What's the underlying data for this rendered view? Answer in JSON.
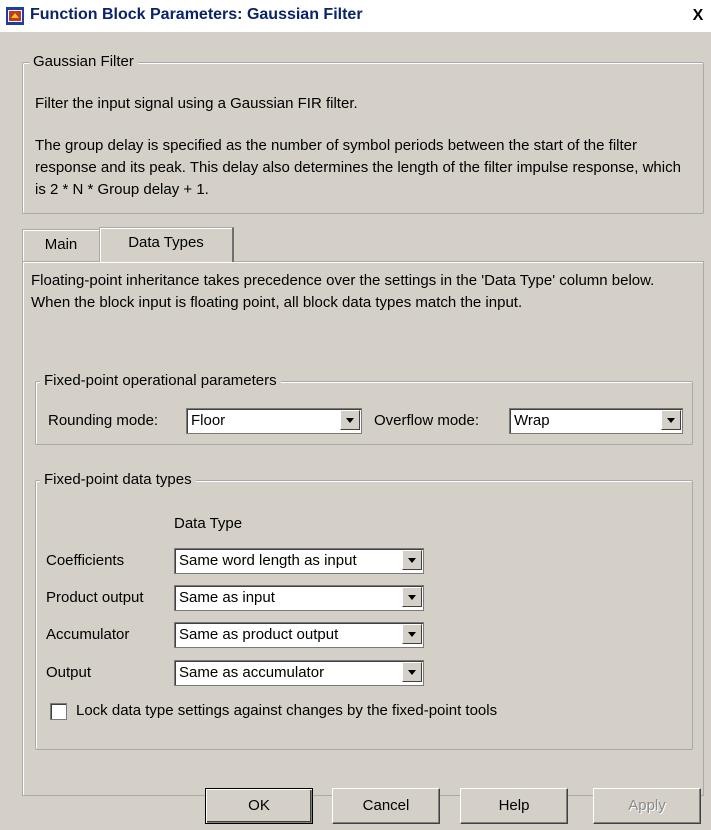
{
  "window": {
    "title": "Function Block Parameters: Gaussian Filter",
    "close_label": "X"
  },
  "description": {
    "group_label": "Gaussian Filter",
    "line1": "Filter the input signal using a Gaussian FIR filter.",
    "line2": "The group delay is specified as the number of symbol periods between the start of the filter response and its peak. This delay also determines the length of the filter impulse response, which is 2 * N * Group delay + 1."
  },
  "tabs": [
    {
      "label": "Main",
      "active": false
    },
    {
      "label": "Data Types",
      "active": true
    }
  ],
  "data_types_tab": {
    "intro": "Floating-point inheritance takes precedence over the settings in the 'Data Type' column below. When the block input is floating point, all block data types match the input.",
    "op_params": {
      "group_label": "Fixed-point operational parameters",
      "rounding_label": "Rounding mode:",
      "rounding_value": "Floor",
      "overflow_label": "Overflow mode:",
      "overflow_value": "Wrap"
    },
    "data_types": {
      "group_label": "Fixed-point data types",
      "column_header": "Data Type",
      "rows": [
        {
          "label": "Coefficients",
          "value": "Same word length as input"
        },
        {
          "label": "Product output",
          "value": "Same as input"
        },
        {
          "label": "Accumulator",
          "value": "Same as product output"
        },
        {
          "label": "Output",
          "value": "Same as accumulator"
        }
      ],
      "lock_label": "Lock data type settings against changes by the fixed-point tools",
      "lock_checked": false
    }
  },
  "buttons": {
    "ok": "OK",
    "cancel": "Cancel",
    "help": "Help",
    "apply": "Apply"
  },
  "colors": {
    "dialog_bg": "#d4d0c8",
    "title_text": "#0a246a"
  }
}
